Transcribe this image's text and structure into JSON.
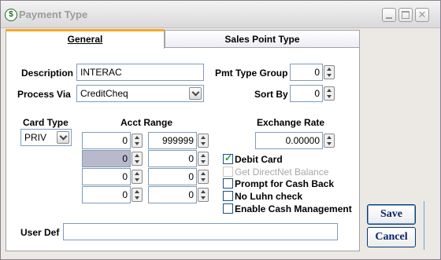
{
  "window": {
    "title": "Payment Type"
  },
  "tabs": [
    {
      "label": "General"
    },
    {
      "label": "Sales Point Type"
    }
  ],
  "general": {
    "description_label": "Description",
    "description_value": "INTERAC",
    "process_via_label": "Process Via",
    "process_via_value": "CreditCheq",
    "pmt_type_group_label": "Pmt Type Group",
    "pmt_type_group_value": "0",
    "sort_by_label": "Sort By",
    "sort_by_value": "0",
    "card_type_label": "Card Type",
    "card_type_value": "PRIV",
    "acct_range_label": "Acct Range",
    "acct_range": [
      {
        "from": "0",
        "to": "999999"
      },
      {
        "from": "0",
        "to": "0"
      },
      {
        "from": "0",
        "to": "0"
      },
      {
        "from": "0",
        "to": "0"
      }
    ],
    "exchange_rate_label": "Exchange Rate",
    "exchange_rate_value": "0.00000",
    "checkboxes": [
      {
        "label": "Debit Card",
        "checked": true,
        "enabled": true
      },
      {
        "label": "Get DirectNet Balance",
        "checked": false,
        "enabled": false
      },
      {
        "label": "Prompt for Cash Back",
        "checked": false,
        "enabled": true
      },
      {
        "label": "No Luhn check",
        "checked": false,
        "enabled": true
      },
      {
        "label": "Enable Cash Management",
        "checked": false,
        "enabled": true
      }
    ],
    "user_def_label": "User Def",
    "user_def_value": ""
  },
  "buttons": {
    "save": "Save",
    "cancel": "Cancel"
  },
  "icons": {
    "app": "payment-dollar-icon"
  }
}
